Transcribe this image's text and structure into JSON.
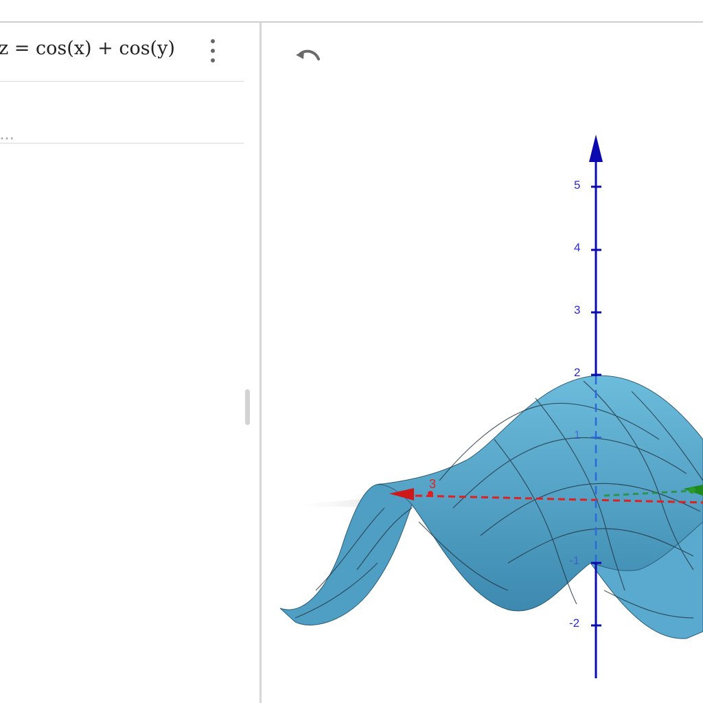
{
  "algebra_view": {
    "formula": "z = cos(x) + cos(y)",
    "input_placeholder": "t..."
  },
  "graphics_view": {
    "z_axis_ticks": [
      "5",
      "4",
      "3",
      "2",
      "1",
      "-1",
      "-2"
    ],
    "x_axis_label": "3",
    "colors": {
      "surface": "#5aaed0",
      "surface_dark": "#3f86aa",
      "z_axis": "#0a0ab0",
      "x_axis": "#e02020",
      "y_axis": "#1e8a1e",
      "mesh": "#1f2f3a"
    }
  }
}
